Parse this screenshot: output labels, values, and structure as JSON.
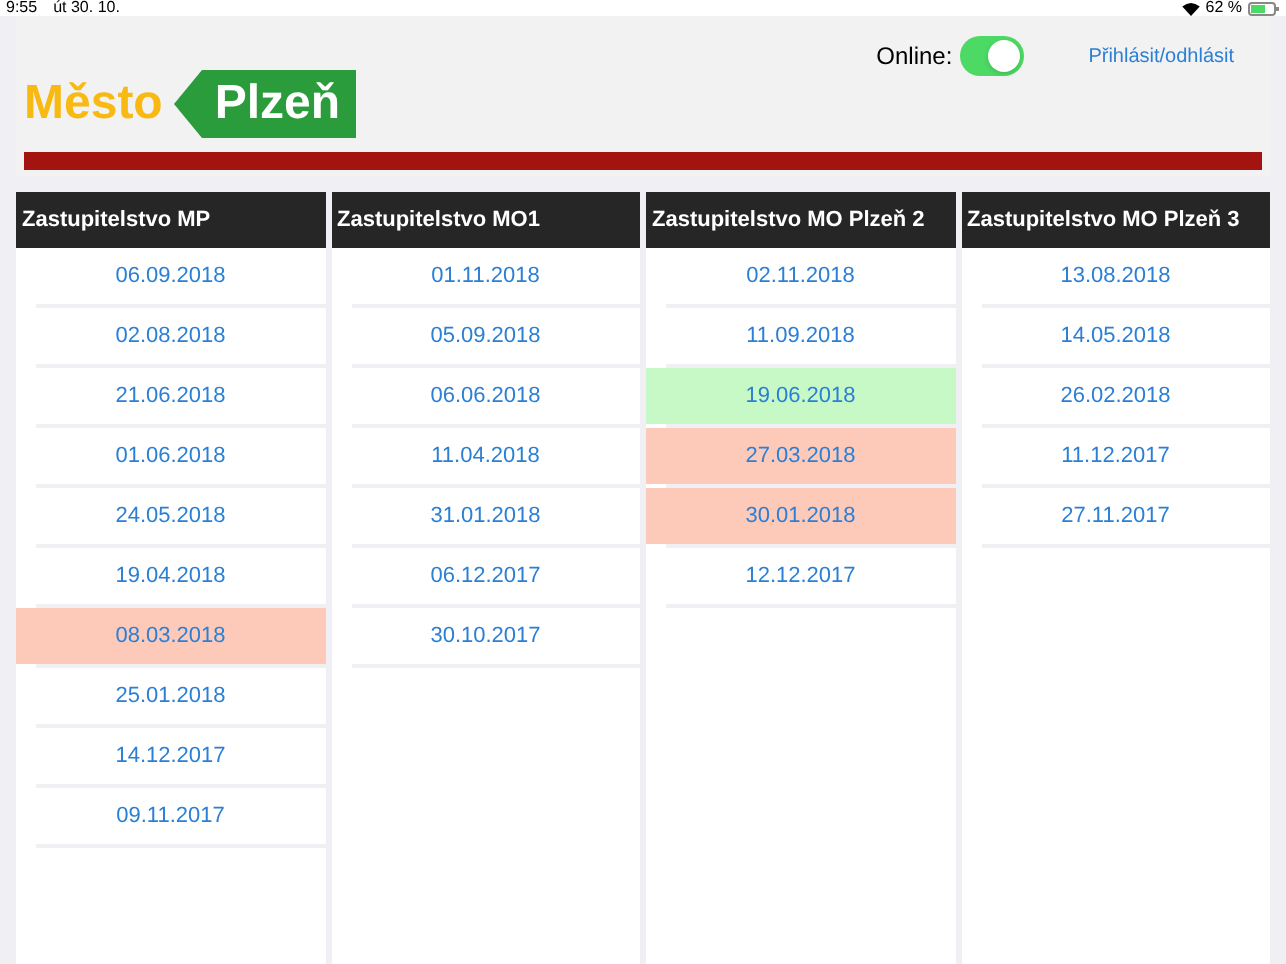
{
  "status_bar": {
    "time": "9:55",
    "date": "út 30. 10.",
    "battery": "62 %"
  },
  "header": {
    "logo_left": "Město",
    "logo_right": "Plzeň",
    "online_label": "Online:",
    "online": true,
    "login_link": "Přihlásit/odhlásit"
  },
  "columns": [
    {
      "title": "Zastupitelstvo MP",
      "dates": [
        {
          "text": "06.09.2018",
          "color": "#ffffff"
        },
        {
          "text": "02.08.2018",
          "color": "#ffffff"
        },
        {
          "text": "21.06.2018",
          "color": "#ffffff"
        },
        {
          "text": "01.06.2018",
          "color": "#ffffff"
        },
        {
          "text": "24.05.2018",
          "color": "#ffffff"
        },
        {
          "text": "19.04.2018",
          "color": "#ffffff"
        },
        {
          "text": "08.03.2018",
          "color": "#fdc9b9"
        },
        {
          "text": "25.01.2018",
          "color": "#ffffff"
        },
        {
          "text": "14.12.2017",
          "color": "#ffffff"
        },
        {
          "text": "09.11.2017",
          "color": "#ffffff"
        }
      ]
    },
    {
      "title": "Zastupitelstvo MO1",
      "dates": [
        {
          "text": "01.11.2018",
          "color": "#ffffff"
        },
        {
          "text": "05.09.2018",
          "color": "#ffffff"
        },
        {
          "text": "06.06.2018",
          "color": "#ffffff"
        },
        {
          "text": "11.04.2018",
          "color": "#ffffff"
        },
        {
          "text": "31.01.2018",
          "color": "#ffffff"
        },
        {
          "text": "06.12.2017",
          "color": "#ffffff"
        },
        {
          "text": "30.10.2017",
          "color": "#ffffff"
        }
      ]
    },
    {
      "title": "Zastupitelstvo MO Plzeň 2",
      "dates": [
        {
          "text": "02.11.2018",
          "color": "#ffffff"
        },
        {
          "text": "11.09.2018",
          "color": "#ffffff"
        },
        {
          "text": "19.06.2018",
          "color": "#c6f9c6"
        },
        {
          "text": "27.03.2018",
          "color": "#fdc9b9"
        },
        {
          "text": "30.01.2018",
          "color": "#fdc9b9"
        },
        {
          "text": "12.12.2017",
          "color": "#ffffff"
        }
      ]
    },
    {
      "title": "Zastupitelstvo MO Plzeň 3",
      "dates": [
        {
          "text": "13.08.2018",
          "color": "#ffffff"
        },
        {
          "text": "14.05.2018",
          "color": "#ffffff"
        },
        {
          "text": "26.02.2018",
          "color": "#ffffff"
        },
        {
          "text": "11.12.2017",
          "color": "#ffffff"
        },
        {
          "text": "27.11.2017",
          "color": "#ffffff"
        }
      ]
    }
  ]
}
